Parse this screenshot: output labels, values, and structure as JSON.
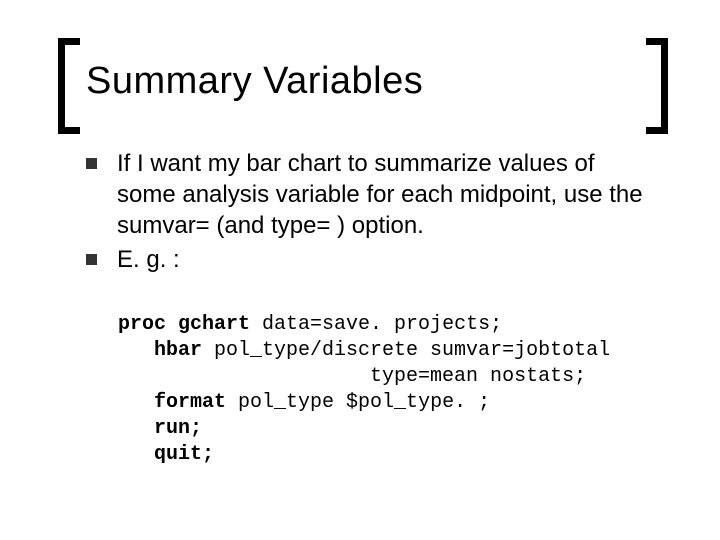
{
  "title": "Summary Variables",
  "bullets": [
    "If I want my bar chart to summarize values of some analysis variable for each midpoint, use the sumvar= (and type= ) option.",
    "E. g. :"
  ],
  "code": {
    "l1a": "proc gchart",
    "l1b": " data=save. projects;",
    "l2a": "   hbar",
    "l2b": " pol_type/discrete sumvar=jobtotal",
    "l3": "                     type=mean nostats;",
    "l4a": "   format",
    "l4b": " pol_type $pol_type. ;",
    "l5": "   run;",
    "l6": "   quit;"
  }
}
